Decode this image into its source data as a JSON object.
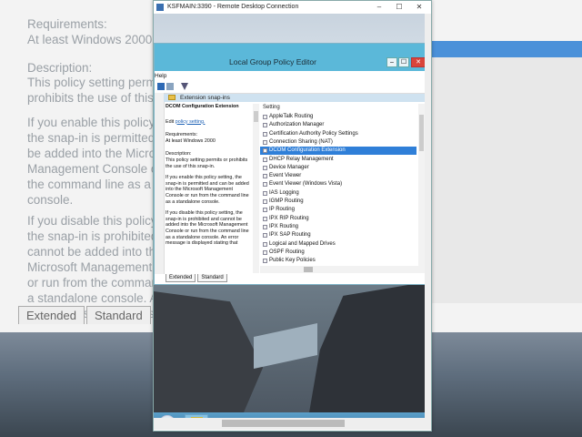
{
  "background": {
    "requirements_heading": "Requirements:",
    "requirements_value": "At least Windows 2000",
    "description_heading": "Description:",
    "description_body": "This policy setting permit\nprohibits the use of this s",
    "para1": "If you enable this policy s\nthe snap-in is permitted a\nbe added into the Microso\nManagement Console or\nthe command line as a st\nconsole.",
    "para2": "If you disable this policy s\nthe snap-in is prohibited a\ncannot be added into the\nMicrosoft Management C\nor run from the comman\na standalone console. An\nmessage is displayed stat",
    "tabs": [
      "Extended",
      "Standard"
    ]
  },
  "rdp": {
    "title": "KSFMAIN:3390 - Remote Desktop Connection",
    "minimize": "–",
    "maximize": "☐",
    "close": "✕"
  },
  "gpe": {
    "title": "Local Group Policy Editor",
    "minimize": "–",
    "maximize": "☐",
    "close": "✕",
    "menu_help": "Help",
    "header_label": "Extension snap-ins",
    "description": {
      "title": "DCOM Configuration Extension",
      "edit_prefix": "Edit",
      "edit_link": "policy setting.",
      "requirements_heading": "Requirements:",
      "requirements_value": "At least Windows 2000",
      "description_heading": "Description:",
      "description_body": "This policy setting permits or prohibits the use of this snap-in.",
      "para1": "If you enable this policy setting, the snap-in is permitted and can be added into the Microsoft Management Console or run from the command line as a standalone console.",
      "para2": "If you disable this policy setting, the snap-in is prohibited and cannot be added into the Microsoft Management Console or run from the command line as a standalone console. An error message is displayed stating that"
    },
    "list_header": "Setting",
    "settings": [
      "AppleTalk Routing",
      "Authorization Manager",
      "Certification Authority Policy Settings",
      "Connection Sharing (NAT)",
      "DCOM Configuration Extension",
      "DHCP Relay Management",
      "Device Manager",
      "Event Viewer",
      "Event Viewer (Windows Vista)",
      "IAS Logging",
      "IGMP Routing",
      "IP Routing",
      "IPX RIP Routing",
      "IPX Routing",
      "IPX SAP Routing",
      "Logical and Mapped Drives",
      "OSPF Routing",
      "Public Key Policies"
    ],
    "selected_setting": "DCOM Configuration Extension",
    "tabs": [
      "Extended",
      "Standard"
    ]
  }
}
